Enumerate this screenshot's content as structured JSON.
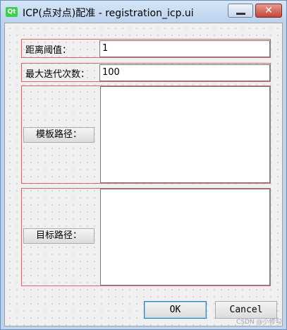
{
  "window": {
    "title": "ICP(点对点)配准 - registration_icp.ui",
    "logo_text": "Qt",
    "close_glyph": "✕"
  },
  "form": {
    "distance_label": "距离阈值：",
    "distance_value": "1",
    "iterations_label": "最大迭代次数：",
    "iterations_value": "100",
    "template_path_button": "模板路径：",
    "target_path_button": "目标路径："
  },
  "buttons": {
    "ok": "OK",
    "cancel": "Cancel"
  },
  "watermark": "CSDN @小修勾"
}
